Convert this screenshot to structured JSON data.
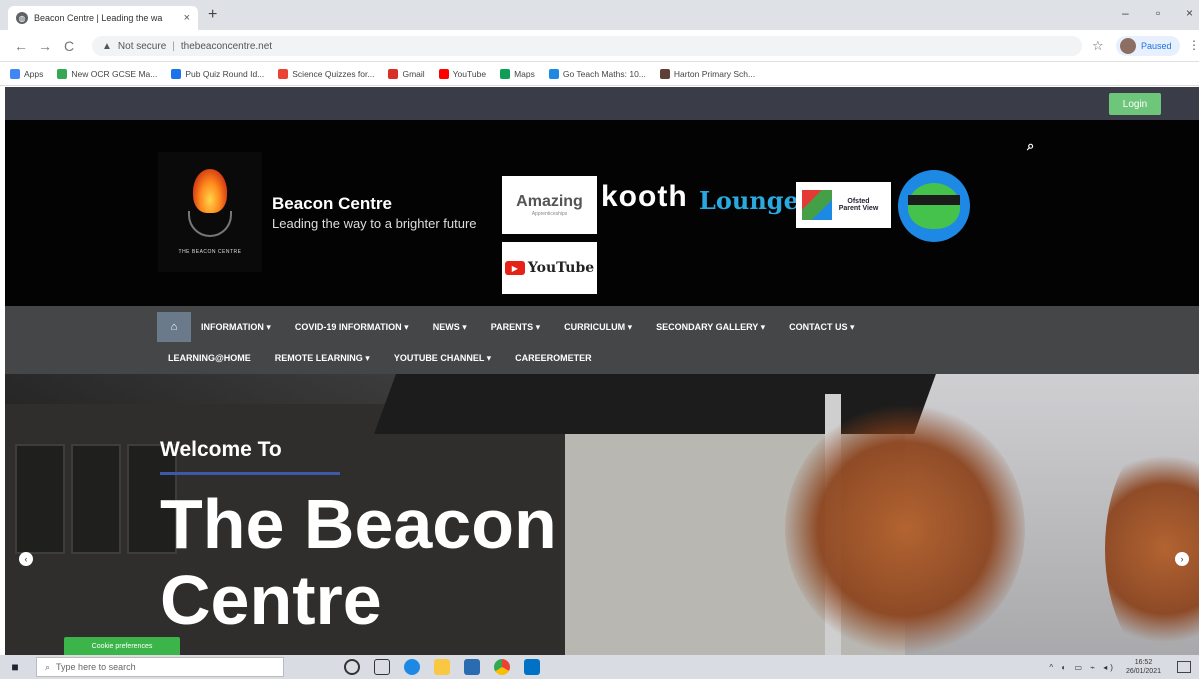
{
  "browser": {
    "tab_title": "Beacon Centre | Leading the wa",
    "tab_close": "×",
    "new_tab": "+",
    "back": "←",
    "forward": "→",
    "reload": "C",
    "security_label": "Not secure",
    "url": "thebeaconcentre.net",
    "profile_label": "Paused",
    "bookmarks": [
      {
        "label": "Apps",
        "color": "#4285f4"
      },
      {
        "label": "New OCR GCSE Ma...",
        "color": "#34a853"
      },
      {
        "label": "Pub Quiz Round Id...",
        "color": "#1a73e8"
      },
      {
        "label": "Science Quizzes for...",
        "color": "#ea4335"
      },
      {
        "label": "Gmail",
        "color": "#d93025"
      },
      {
        "label": "YouTube",
        "color": "#ff0000"
      },
      {
        "label": "Maps",
        "color": "#0f9d58"
      },
      {
        "label": "Go Teach Maths: 10...",
        "color": "#1e88e5"
      },
      {
        "label": "Harton Primary Sch...",
        "color": "#5d4037"
      }
    ]
  },
  "site": {
    "login_label": "Login",
    "logo_caption": "THE BEACON CENTRE",
    "name": "Beacon Centre",
    "tagline": "Leading the way to a brighter future",
    "badges": {
      "amazing": "Amazing",
      "amazing_sub": "Apprenticeships",
      "kooth": "kooth",
      "lounge": "Lounge",
      "parent_view": "Parent View",
      "parent_view_org": "Ofsted",
      "youtube": "YouTube"
    },
    "nav_row1": [
      "INFORMATION ▾",
      "COVID-19 INFORMATION ▾",
      "NEWS ▾",
      "PARENTS ▾",
      "CURRICULUM ▾",
      "SECONDARY GALLERY ▾",
      "CONTACT US ▾"
    ],
    "nav_row2": [
      "LEARNING@HOME",
      "REMOTE LEARNING ▾",
      "YOUTUBE CHANNEL ▾",
      "CAREEROMETER"
    ],
    "hero": {
      "welcome": "Welcome To",
      "title": "The Beacon Centre"
    },
    "cookie_label": "Cookie preferences"
  },
  "taskbar": {
    "search_placeholder": "Type here to search",
    "time": "16:52",
    "date": "26/01/2021"
  },
  "icons": {
    "home": "⌂",
    "search": "🔍",
    "star": "☆",
    "prev": "‹",
    "next": "›"
  }
}
